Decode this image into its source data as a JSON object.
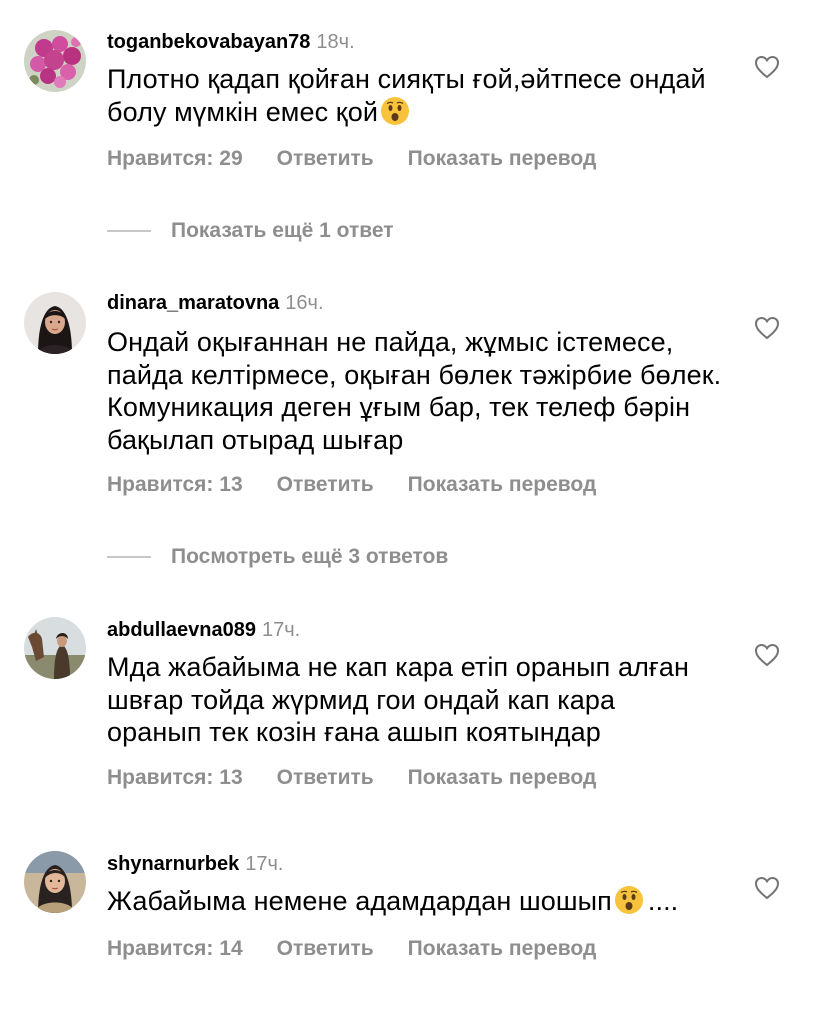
{
  "comments": [
    {
      "username": "toganbekovabayan78",
      "time": "18ч.",
      "text": "Плотно қадап қойған сияқты ғой,әйтпесе ондай болу мүмкін емес қой",
      "likes": "Нравится: 29",
      "reply": "Ответить",
      "translate": "Показать перевод",
      "emoji": "astonished-face-emoji"
    },
    {
      "username": "dinara_maratovna",
      "time": "16ч.",
      "text": "Ондай оқығаннан не пайда, жұмыс істемесе, пайда келтірмесе, оқыған бөлек тәжірбие бөлек. Комуникация деген ұғым бар, тек телеф бәрін бақылап отырад шығар",
      "likes": "Нравится: 13",
      "reply": "Ответить",
      "translate": "Показать перевод"
    },
    {
      "username": "abdullaevna089",
      "time": "17ч.",
      "text": "Мда жабайыма не кап кара етіп оранып алған швғар тойда жүрмид гои ондай кап кара оранып тек козін ғана ашып коятындар",
      "likes": "Нравится: 13",
      "reply": "Ответить",
      "translate": "Показать перевод"
    },
    {
      "username": "shynarnurbek",
      "time": "17ч.",
      "text": "Жабайыма немене адамдардан шошып",
      "text_suffix": "....",
      "likes": "Нравится: 14",
      "reply": "Ответить",
      "translate": "Показать перевод",
      "emoji": "astonished-face-emoji"
    }
  ],
  "view_more": [
    "Показать ещё 1 ответ",
    "Посмотреть ещё 3 ответов"
  ],
  "colors": {
    "text": "#000000",
    "secondary": "#8e8e8e",
    "divider": "#c7c7c7",
    "background": "#ffffff"
  }
}
